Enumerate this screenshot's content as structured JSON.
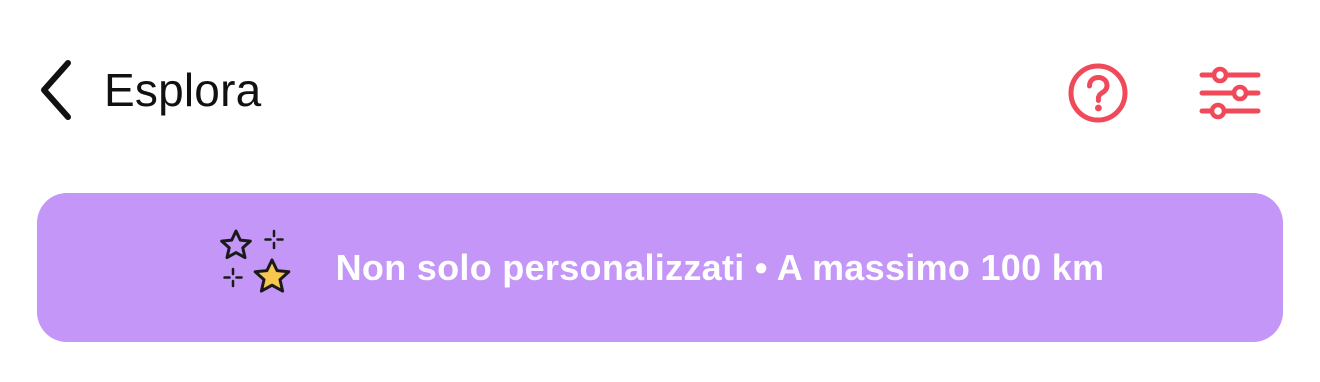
{
  "header": {
    "title": "Esplora",
    "back_icon": "chevron-left-icon",
    "help_icon": "question-circle-icon",
    "filters_icon": "sliders-icon"
  },
  "banner": {
    "icon": "sparkles-stars-icon",
    "text": "Non solo personalizzati • A massimo 100 km"
  },
  "colors": {
    "accent": "#f04a5a",
    "banner_background": "#c396f7",
    "banner_text": "#ffffff",
    "title_text": "#111111",
    "star_fill": "#f9c74f"
  }
}
